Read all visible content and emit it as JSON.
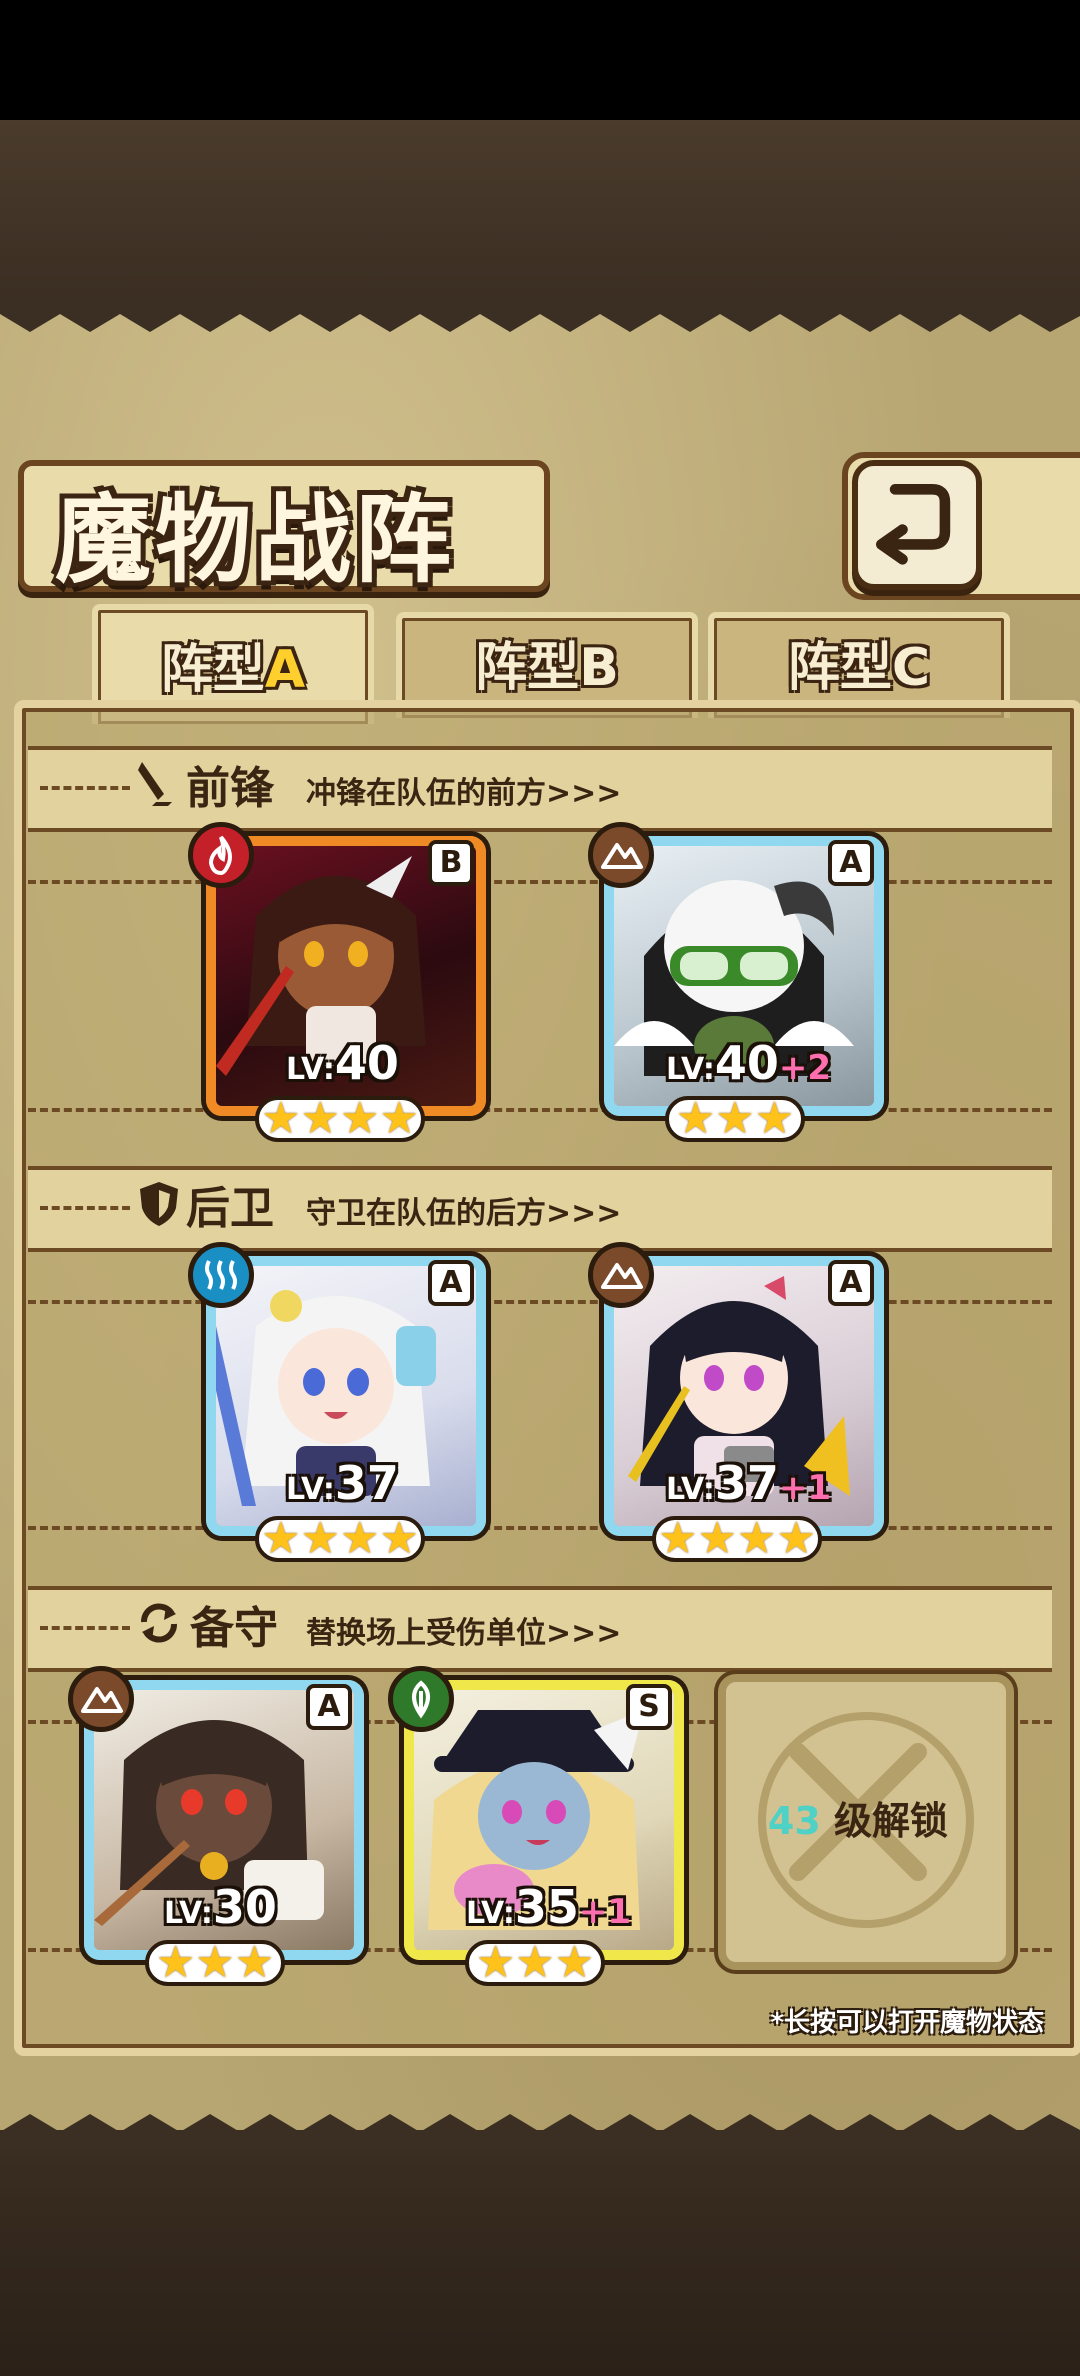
{
  "screen": {
    "title": "魔物战阵"
  },
  "tabs": [
    {
      "prefix": "阵型",
      "suffix": "A",
      "active": true
    },
    {
      "prefix": "阵型",
      "suffix": "B",
      "active": false
    },
    {
      "prefix": "阵型",
      "suffix": "C",
      "active": false
    }
  ],
  "sections": {
    "vanguard": {
      "title": "前锋",
      "subtitle": "冲锋在队伍的前方>>>"
    },
    "rearguard": {
      "title": "后卫",
      "subtitle": "守卫在队伍的后方>>>"
    },
    "reserve": {
      "title": "备守",
      "subtitle": "替换场上受伤单位>>>"
    }
  },
  "monsters": {
    "vanguard_1": {
      "rank": "B",
      "level_prefix": "LV:",
      "level": "40",
      "plus": "",
      "stars": 4,
      "element": "fire",
      "frame_color": "#f08a24"
    },
    "vanguard_2": {
      "rank": "A",
      "level_prefix": "LV:",
      "level": "40",
      "plus": "+2",
      "stars": 3,
      "element": "earth",
      "frame_color": "#8fd8f0"
    },
    "rear_1": {
      "rank": "A",
      "level_prefix": "LV:",
      "level": "37",
      "plus": "",
      "stars": 4,
      "element": "water",
      "frame_color": "#8fd8f0"
    },
    "rear_2": {
      "rank": "A",
      "level_prefix": "LV:",
      "level": "37",
      "plus": "+1",
      "stars": 4,
      "element": "earth",
      "frame_color": "#8fd8f0"
    },
    "reserve_1": {
      "rank": "A",
      "level_prefix": "LV:",
      "level": "30",
      "plus": "",
      "stars": 3,
      "element": "earth",
      "frame_color": "#8fd8f0"
    },
    "reserve_2": {
      "rank": "S",
      "level_prefix": "LV:",
      "level": "35",
      "plus": "+1",
      "stars": 3,
      "element": "wood",
      "frame_color": "#f0e84a"
    }
  },
  "locked_slot": {
    "level": "43",
    "text": "级解锁"
  },
  "hint": "*长按可以打开魔物状态",
  "icons": {
    "back": "back-arrow-icon",
    "fire": "fire-element-icon",
    "earth": "earth-element-icon",
    "water": "water-element-icon",
    "wood": "wood-element-icon",
    "star": "star-icon"
  },
  "colors": {
    "fire": "#c4202a",
    "earth": "#7a4a2a",
    "water": "#1a8fc4",
    "wood": "#2f7a2a",
    "star": "#ffc21a",
    "active_tab_letter": "#ffcf2e"
  }
}
